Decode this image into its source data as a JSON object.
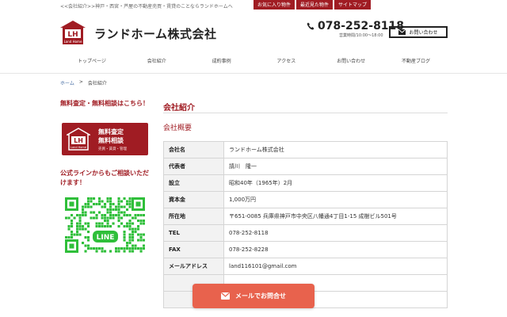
{
  "header": {
    "tagline": "<<会社紹介>>神戸・西宮・芦屋の不動産売買・賃貸のことならランドホームへ",
    "top_links": [
      "お気に入り物件",
      "最近見た物件",
      "サイトマップ"
    ],
    "logo_text": "LH",
    "logo_sub": "Land Home",
    "site_name": "ランドホーム株式会社",
    "phone": "078-252-8118",
    "hours": "営業時間/10:00～18:00",
    "mail_button": "お問い合わせ"
  },
  "nav": [
    "トップページ",
    "会社紹介",
    "成約事例",
    "アクセス",
    "お問い合わせ",
    "不動産ブログ"
  ],
  "breadcrumb": {
    "home": "ホーム",
    "sep": ">",
    "current": "会社紹介"
  },
  "sidebar": {
    "heading1": "無料査定・無料相談はこちら！",
    "banner_line1": "無料査定",
    "banner_line2": "無料相談",
    "banner_sub": "売買・賃貸・管理",
    "heading2": "公式ラインからもご相談いただけます！",
    "qr_label": "LINE"
  },
  "main": {
    "title": "会社紹介",
    "subtitle": "会社概要",
    "rows": [
      {
        "label": "会社名",
        "value": "ランドホーム株式会社"
      },
      {
        "label": "代表者",
        "value": "請川　隆一"
      },
      {
        "label": "設立",
        "value": "昭和40年（1965年）2月"
      },
      {
        "label": "資本金",
        "value": "1,000万円"
      },
      {
        "label": "所在地",
        "value": "〒651-0085 兵庫県神戸市中央区八幡通4丁目1-15 成樹ビル501号"
      },
      {
        "label": "TEL",
        "value": "078-252-8118"
      },
      {
        "label": "FAX",
        "value": "078-252-8228"
      },
      {
        "label": "メールアドレス",
        "value": "land116101@gmail.com"
      }
    ]
  },
  "cta": {
    "label": "メールでお問合せ"
  },
  "colors": {
    "brand": "#a01c23",
    "cta": "#e8624d",
    "line_green": "#2fbf3a"
  }
}
